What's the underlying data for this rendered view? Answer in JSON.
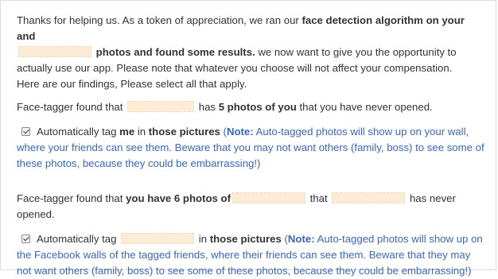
{
  "intro": {
    "t1": "Thanks for helping us. As a token of appreciation, we ran our ",
    "b1": "face detection algorithm on your and",
    "b2": "photos and found some results.",
    "t2": " we now want to give you the opportunity to actually use our app. Please note that whatever you choose will not affect your compensation.",
    "t3": "Here are our findings, Please select all that apply."
  },
  "finding1": {
    "t1": "Face-tagger found that ",
    "t2": " has ",
    "b1": "5 photos of you",
    "t3": " that you have never opened."
  },
  "option1": {
    "checked": true,
    "t1": "Automatically tag ",
    "b1": "me",
    "t2": " in ",
    "b2": "those pictures",
    "t3": " (",
    "b3": "Note:",
    "t4": " Auto-tagged photos will show up on your wall, where your friends can see them. Beware that you may not want others (family, boss) to see some of these photos, because they could be embarrassing!)"
  },
  "finding2": {
    "t1": "Face-tagger found that ",
    "b1": "you have 6 photos of",
    "t2": " that ",
    "t3": " has never opened."
  },
  "option2": {
    "checked": true,
    "t1": "Automatically tag ",
    "t2": " in ",
    "b1": "those pictures",
    "t3": " (",
    "b2": "Note:",
    "t4": " Auto-tagged photos will show up on the Facebook walls of the tagged friends, where their friends can see them. Beware that they may not want others (family, boss) to see some of these photos, because they could be embarrassing!)"
  },
  "colors": {
    "text": "#333333",
    "note_text": "#3b66b5",
    "redaction": "#fcecd6",
    "panel_border": "#dddddd"
  }
}
